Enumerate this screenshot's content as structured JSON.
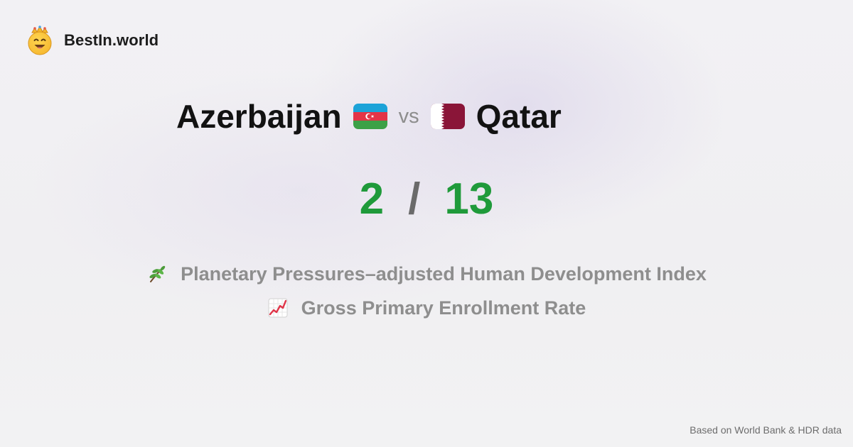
{
  "brand": {
    "name": "BestIn.world",
    "logo_icon": "crowned-smiley-icon"
  },
  "comparison": {
    "left": {
      "name": "Azerbaijan",
      "flag_icon": "azerbaijan-flag-icon",
      "score": "2"
    },
    "separator": "vs",
    "right": {
      "name": "Qatar",
      "flag_icon": "qatar-flag-icon",
      "score": "13"
    },
    "score_separator": "/"
  },
  "metrics": [
    {
      "icon": "herb-icon",
      "label": "Planetary Pressures–adjusted Human Development Index"
    },
    {
      "icon": "chart-increasing-icon",
      "label": "Gross Primary Enrollment Rate"
    }
  ],
  "footer": {
    "source": "Based on World Bank & HDR data"
  },
  "colors": {
    "score": "#1f9a3a",
    "muted": "#8e8e8e",
    "text": "#121212"
  }
}
